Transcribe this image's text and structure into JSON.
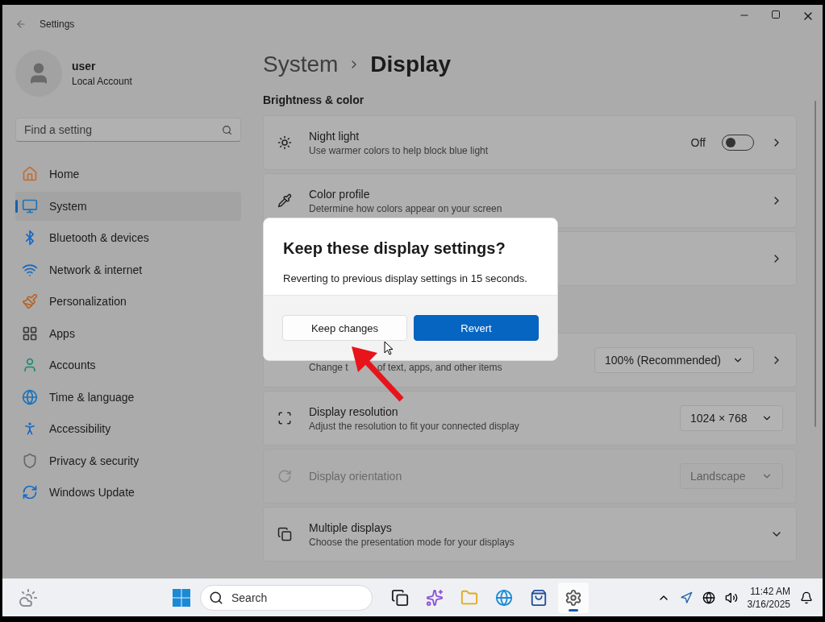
{
  "window": {
    "title": "Settings"
  },
  "account": {
    "name": "user",
    "type": "Local Account"
  },
  "search": {
    "placeholder": "Find a setting"
  },
  "nav": [
    {
      "label": "Home",
      "selected": false
    },
    {
      "label": "System",
      "selected": true
    },
    {
      "label": "Bluetooth & devices",
      "selected": false
    },
    {
      "label": "Network & internet",
      "selected": false
    },
    {
      "label": "Personalization",
      "selected": false
    },
    {
      "label": "Apps",
      "selected": false
    },
    {
      "label": "Accounts",
      "selected": false
    },
    {
      "label": "Time & language",
      "selected": false
    },
    {
      "label": "Accessibility",
      "selected": false
    },
    {
      "label": "Privacy & security",
      "selected": false
    },
    {
      "label": "Windows Update",
      "selected": false
    }
  ],
  "breadcrumb": {
    "parent": "System",
    "current": "Display"
  },
  "section": "Brightness & color",
  "settings": [
    {
      "kind": "toggle",
      "title": "Night light",
      "subtitle": "Use warmer colors to help block blue light",
      "state_label": "Off",
      "on": false,
      "disabled": false
    },
    {
      "kind": "link",
      "title": "Color profile",
      "subtitle": "Determine how colors appear on your screen",
      "disabled": false
    },
    {
      "kind": "link",
      "disabled": false
    },
    {
      "kind": "dropdown",
      "subtitle_parts": [
        "Change t",
        "of text, apps, and other items"
      ],
      "value": "100% (Recommended)",
      "chevron": true,
      "disabled": false
    },
    {
      "kind": "dropdown",
      "title": "Display resolution",
      "subtitle": "Adjust the resolution to fit your connected display",
      "value": "1024 × 768",
      "chevron": false,
      "disabled": false
    },
    {
      "kind": "dropdown",
      "title": "Display orientation",
      "value": "Landscape",
      "chevron": false,
      "disabled": true
    },
    {
      "kind": "expander",
      "title": "Multiple displays",
      "subtitle": "Choose the presentation mode for your displays",
      "disabled": false
    }
  ],
  "dialog": {
    "title": "Keep these display settings?",
    "message": "Reverting to previous display settings in 15 seconds.",
    "buttons": [
      {
        "label": "Keep changes",
        "primary": false
      },
      {
        "label": "Revert",
        "primary": true
      }
    ]
  },
  "taskbar": {
    "search_placeholder": "Search",
    "apps": [
      {
        "kind": "taskview",
        "selected": false
      },
      {
        "kind": "copilot",
        "selected": false
      },
      {
        "kind": "files",
        "selected": false
      },
      {
        "kind": "edge",
        "selected": false
      },
      {
        "kind": "store",
        "selected": false
      },
      {
        "kind": "settings",
        "selected": true
      }
    ],
    "time": "11:42 AM",
    "date": "3/16/2025"
  }
}
